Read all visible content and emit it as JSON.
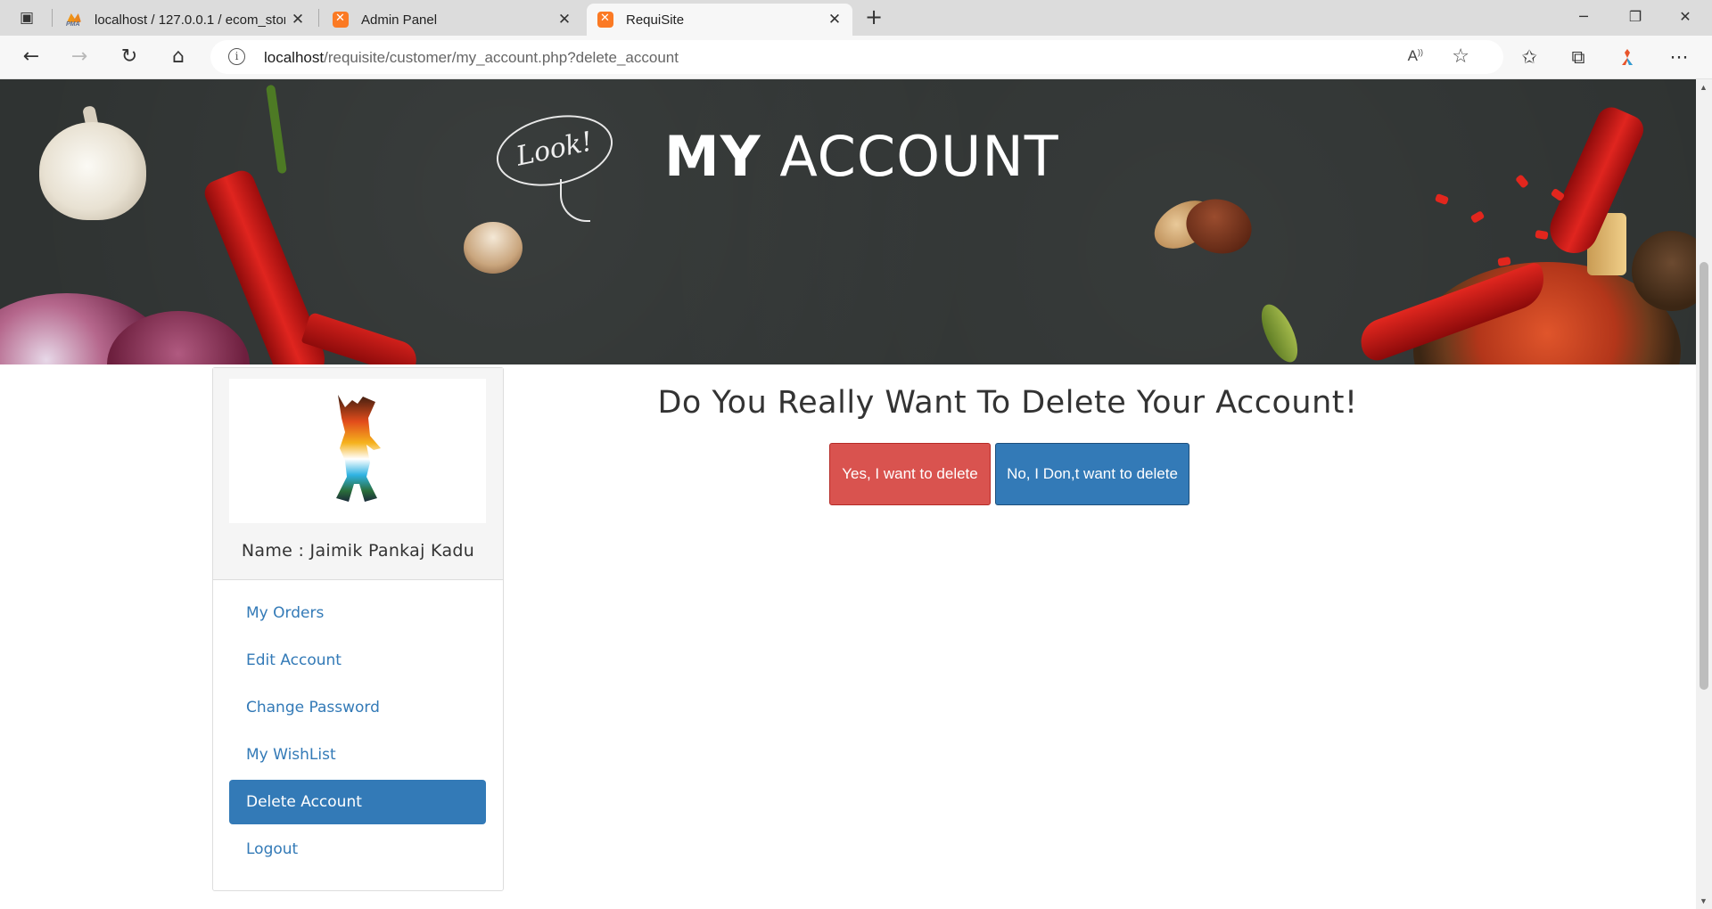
{
  "browser": {
    "tabs": [
      {
        "title": "localhost / 127.0.0.1 / ecom_stor",
        "favicon": "phpmyadmin-icon",
        "active": false
      },
      {
        "title": "Admin Panel",
        "favicon": "xampp-icon",
        "active": false
      },
      {
        "title": "RequiSite",
        "favicon": "xampp-icon",
        "active": true
      }
    ],
    "url_host": "localhost",
    "url_path": "/requisite/customer/my_account.php?delete_account"
  },
  "hero": {
    "title_bold": "MY",
    "title_light": "ACCOUNT",
    "badge_text": "Look!"
  },
  "sidebar": {
    "name_label": "Name : Jaimik Pankaj Kadu",
    "items": [
      {
        "label": "My Orders",
        "active": false
      },
      {
        "label": "Edit Account",
        "active": false
      },
      {
        "label": "Change Password",
        "active": false
      },
      {
        "label": "My WishList",
        "active": false
      },
      {
        "label": "Delete Account",
        "active": true
      },
      {
        "label": "Logout",
        "active": false
      }
    ]
  },
  "main": {
    "question": "Do You Really Want To Delete Your Account!",
    "yes_label": "Yes, I want to delete",
    "no_label": "No, I Don,t want to delete"
  },
  "colors": {
    "primary": "#337ab7",
    "danger": "#d9534f",
    "hero_bg": "#2f3332"
  }
}
